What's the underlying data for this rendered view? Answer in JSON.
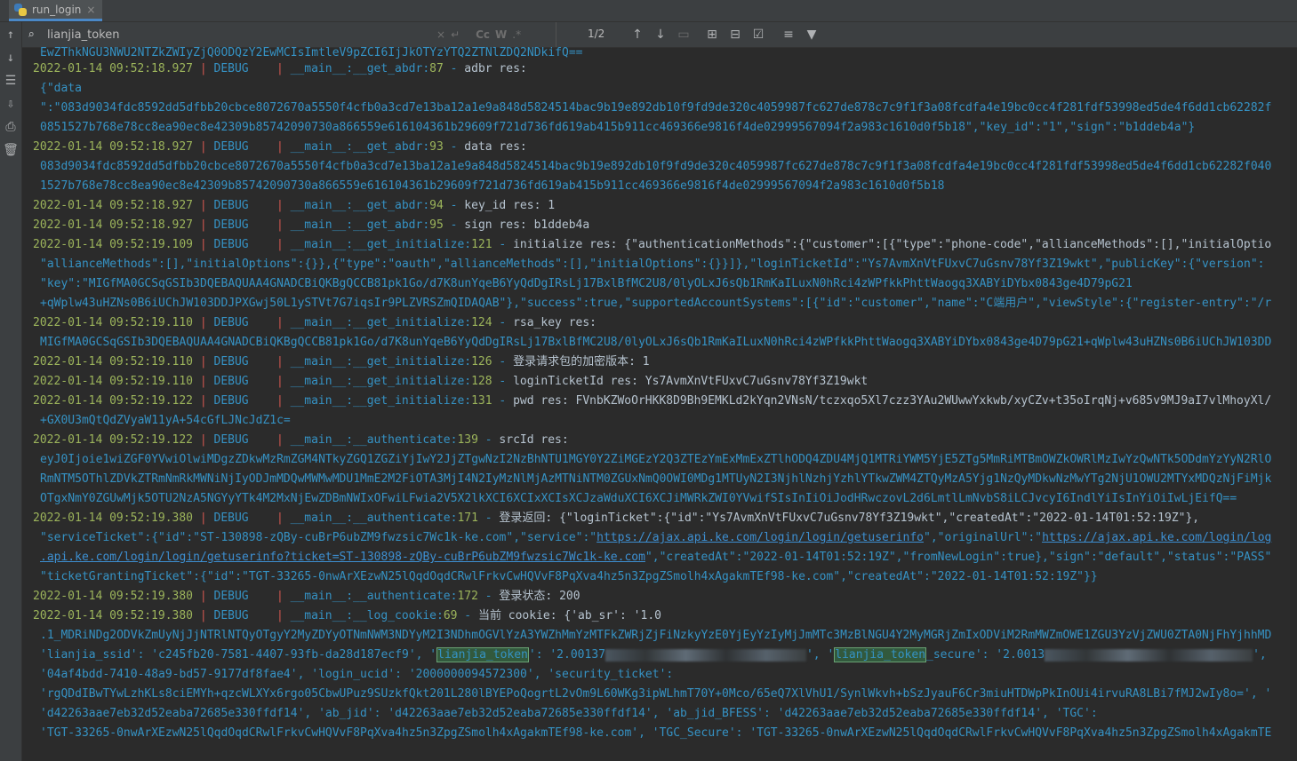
{
  "tab": {
    "label": "run_login",
    "close": "×"
  },
  "search": {
    "query": "lianjia_token",
    "match_count": "1/2",
    "opt_case": "Cc",
    "opt_words": "W",
    "opt_regex": ".*"
  },
  "lines": [
    {
      "type": "cont",
      "text": "EwZThkNGU3NWU2NTZkZWIyZjQ0ODQzY2EwMCIsImtleV9pZCI6IjJkOTYzYTQ2ZTNlZDQ2NDkifQ=="
    },
    {
      "type": "log",
      "ts": "2022-01-14 09:52:18.927",
      "lvl": "DEBUG",
      "mod": "__main__:__get_abdr",
      "ln": "87",
      "msg": "adbr res:"
    },
    {
      "type": "cont",
      "text": "{\"data"
    },
    {
      "type": "cont",
      "text": "\":\"083d9034fdc8592dd5dfbb20cbce8072670a5550f4cfb0a3cd7e13ba12a1e9a848d5824514bac9b19e892db10f9fd9de320c4059987fc627de878c7c9f1f3a08fcdfa4e19bc0cc4f281fdf53998ed5de4f6dd1cb62282f"
    },
    {
      "type": "cont",
      "text": "0851527b768e78cc8ea90ec8e42309b85742090730a866559e616104361b29609f721d736fd619ab415b911cc469366e9816f4de02999567094f2a983c1610d0f5b18\",\"key_id\":\"1\",\"sign\":\"b1ddeb4a\"}"
    },
    {
      "type": "log",
      "ts": "2022-01-14 09:52:18.927",
      "lvl": "DEBUG",
      "mod": "__main__:__get_abdr",
      "ln": "93",
      "msg": "data res:"
    },
    {
      "type": "cont",
      "text": "083d9034fdc8592dd5dfbb20cbce8072670a5550f4cfb0a3cd7e13ba12a1e9a848d5824514bac9b19e892db10f9fd9de320c4059987fc627de878c7c9f1f3a08fcdfa4e19bc0cc4f281fdf53998ed5de4f6dd1cb62282f040"
    },
    {
      "type": "cont",
      "text": "1527b768e78cc8ea90ec8e42309b85742090730a866559e616104361b29609f721d736fd619ab415b911cc469366e9816f4de02999567094f2a983c1610d0f5b18"
    },
    {
      "type": "log",
      "ts": "2022-01-14 09:52:18.927",
      "lvl": "DEBUG",
      "mod": "__main__:__get_abdr",
      "ln": "94",
      "msg": "key_id res: 1"
    },
    {
      "type": "log",
      "ts": "2022-01-14 09:52:18.927",
      "lvl": "DEBUG",
      "mod": "__main__:__get_abdr",
      "ln": "95",
      "msg": "sign res: b1ddeb4a"
    },
    {
      "type": "log",
      "ts": "2022-01-14 09:52:19.109",
      "lvl": "DEBUG",
      "mod": "__main__:__get_initialize",
      "ln": "121",
      "msg": "initialize res: {\"authenticationMethods\":{\"customer\":[{\"type\":\"phone-code\",\"allianceMethods\":[],\"initialOptio"
    },
    {
      "type": "cont",
      "text": "\"allianceMethods\":[],\"initialOptions\":{}},{\"type\":\"oauth\",\"allianceMethods\":[],\"initialOptions\":{}}]},\"loginTicketId\":\"Ys7AvmXnVtFUxvC7uGsnv78Yf3Z19wkt\",\"publicKey\":{\"version\":"
    },
    {
      "type": "cont",
      "text": "\"key\":\"MIGfMA0GCSqGSIb3DQEBAQUAA4GNADCBiQKBgQCCB81pk1Go/d7K8unYqeB6YyQdDgIRsLj17BxlBfMC2U8/0lyOLxJ6sQb1RmKaILuxN0hRci4zWPfkkPhttWaogq3XABYiDYbx0843ge4D79pG21"
    },
    {
      "type": "cont",
      "text": "+qWplw43uHZNs0B6iUChJW103DDJPXGwj50L1ySTVt7G7iqsIr9PLZVRSZmQIDAQAB\"},\"success\":true,\"supportedAccountSystems\":[{\"id\":\"customer\",\"name\":\"C端用户\",\"viewStyle\":{\"register-entry\":\"/r"
    },
    {
      "type": "log",
      "ts": "2022-01-14 09:52:19.110",
      "lvl": "DEBUG",
      "mod": "__main__:__get_initialize",
      "ln": "124",
      "msg": "rsa_key res:"
    },
    {
      "type": "cont",
      "text": "MIGfMA0GCSqGSIb3DQEBAQUAA4GNADCBiQKBgQCCB81pk1Go/d7K8unYqeB6YyQdDgIRsLj17BxlBfMC2U8/0lyOLxJ6sQb1RmKaILuxN0hRci4zWPfkkPhttWaogq3XABYiDYbx0843ge4D79pG21+qWplw43uHZNs0B6iUChJW103DD"
    },
    {
      "type": "log",
      "ts": "2022-01-14 09:52:19.110",
      "lvl": "DEBUG",
      "mod": "__main__:__get_initialize",
      "ln": "126",
      "msg": "登录请求包的加密版本: 1"
    },
    {
      "type": "log",
      "ts": "2022-01-14 09:52:19.110",
      "lvl": "DEBUG",
      "mod": "__main__:__get_initialize",
      "ln": "128",
      "msg": "loginTicketId res: Ys7AvmXnVtFUxvC7uGsnv78Yf3Z19wkt"
    },
    {
      "type": "log",
      "ts": "2022-01-14 09:52:19.122",
      "lvl": "DEBUG",
      "mod": "__main__:__get_initialize",
      "ln": "131",
      "msg": "pwd res: FVnbKZWoOrHKK8D9Bh9EMKLd2kYqn2VNsN/tczxqo5Xl7czz3YAu2WUwwYxkwb/xyCZv+t35oIrqNj+v685v9MJ9aI7vlMhoyXl/"
    },
    {
      "type": "cont",
      "text": "+GX0U3mQtQdZVyaW11yA+54cGfLJNcJdZ1c="
    },
    {
      "type": "log",
      "ts": "2022-01-14 09:52:19.122",
      "lvl": "DEBUG",
      "mod": "__main__:__authenticate",
      "ln": "139",
      "msg": "srcId res:"
    },
    {
      "type": "cont",
      "text": "eyJ0Ijoie1wiZGF0YVwiOlwiMDgzZDkwMzRmZGM4NTkyZGQ1ZGZiYjIwY2JjZTgwNzI2NzBhNTU1MGY0Y2ZiMGEzY2Q3ZTEzYmExMmExZTlhODQ4ZDU4MjQ1MTRiYWM5YjE5ZTg5MmRiMTBmOWZkOWRlMzIwYzQwNTk5ODdmYzYyN2RlO"
    },
    {
      "type": "cont",
      "text": "RmNTM5OThlZDVkZTRmNmRkMWNiNjIyODJmMDQwMWMwMDU1MmE2M2FiOTA3MjI4N2IyMzNlMjAzMTNiNTM0ZGUxNmQ0OWI0MDg1MTUyN2I3NjhlNzhjYzhlYTkwZWM4ZTQyMzA5Yjg1NzQyMDkwNzMwYTg2NjU1OWU2MTYxMDQzNjFiMjk"
    },
    {
      "type": "cont",
      "text": "OTgxNmY0ZGUwMjk5OTU2NzA5NGYyYTk4M2MxNjEwZDBmNWIxOFwiLFwia2V5X2lkXCI6XCIxXCIsXCJzaWduXCI6XCJiMWRkZWI0YVwifSIsInIiOiJodHRwczovL2d6LmtlLmNvbS8iLCJvcyI6IndlYiIsInYiOiIwLjEifQ=="
    },
    {
      "type": "log",
      "ts": "2022-01-14 09:52:19.380",
      "lvl": "DEBUG",
      "mod": "__main__:__authenticate",
      "ln": "171",
      "msg": "登录返回: {\"loginTicket\":{\"id\":\"Ys7AvmXnVtFUxvC7uGsnv78Yf3Z19wkt\",\"createdAt\":\"2022-01-14T01:52:19Z\"},"
    },
    {
      "type": "svc",
      "pre": "\"serviceTicket\":{\"id\":\"ST-130898-zQBy-cuBrP6ubZM9fwzsic7Wc1k-ke.com\",\"service\":\"",
      "link1": "https://ajax.api.ke.com/login/login/getuserinfo",
      "mid": "\",\"originalUrl\":\"",
      "link2": "https://ajax.api.ke.com/login/log"
    },
    {
      "type": "svc2",
      "link": ".api.ke.com/login/login/getuserinfo?ticket=ST-130898-zQBy-cuBrP6ubZM9fwzsic7Wc1k-ke.com",
      "post": "\",\"createdAt\":\"2022-01-14T01:52:19Z\",\"fromNewLogin\":true},\"sign\":\"default\",\"status\":\"PASS\""
    },
    {
      "type": "cont",
      "text": "\"ticketGrantingTicket\":{\"id\":\"TGT-33265-0nwArXEzwN25lQqdOqdCRwlFrkvCwHQVvF8PqXva4hz5n3ZpgZSmolh4xAgakmTEf98-ke.com\",\"createdAt\":\"2022-01-14T01:52:19Z\"}}"
    },
    {
      "type": "log",
      "ts": "2022-01-14 09:52:19.380",
      "lvl": "DEBUG",
      "mod": "__main__:__authenticate",
      "ln": "172",
      "msg": "登录状态: 200"
    },
    {
      "type": "log",
      "ts": "2022-01-14 09:52:19.380",
      "lvl": "DEBUG",
      "mod": "__main__:__log_cookie",
      "ln": "69",
      "msg": "当前 cookie: {'ab_sr': '1.0"
    },
    {
      "type": "cont",
      "text": ".1_MDRiNDg2ODVkZmUyNjJjNTRlNTQyOTgyY2MyZDYyOTNmNWM3NDYyM2I3NDhmOGVlYzA3YWZhMmYzMTFkZWRjZjFiNzkyYzE0YjEyYzIyMjJmMTc3MzBlNGU4Y2MyMGRjZmIxODViM2RmMWZmOWE1ZGU3YzVjZWU0ZTA0NjFhYjhhMD"
    },
    {
      "type": "tok",
      "a": "'lianjia_ssid': 'c245fb20-7581-4407-93fb-da28d187ecf9', '",
      "hl1": "lianjia_token",
      "b": "': '2.00137",
      "c": "', '",
      "hl2": "lianjia_token",
      "d": "_secure': '2.0013",
      "e": "',"
    },
    {
      "type": "cont",
      "text": "'04af4bdd-7410-48a9-bd57-9177df8fae4', 'login_ucid': '2000000094572300', 'security_ticket':"
    },
    {
      "type": "cont",
      "text": "'rgQDdIBwTYwLzhKLs8ciEMYh+qzcWLXYx6rgo05CbwUPuz9SUzkfQkt201L280lBYEPoQogrtL2vOm9L60WKg3ipWLhmT70Y+0Mco/65eQ7XlVhU1/SynlWkvh+bSzJyauF6Cr3miuHTDWpPkInOUi4irvuRA8LBi7fMJ2wIy8o=', '"
    },
    {
      "type": "cont",
      "text": "'d42263aae7eb32d52eaba72685e330ffdf14', 'ab_jid': 'd42263aae7eb32d52eaba72685e330ffdf14', 'ab_jid_BFESS': 'd42263aae7eb32d52eaba72685e330ffdf14', 'TGC':"
    },
    {
      "type": "cont",
      "text": "'TGT-33265-0nwArXEzwN25lQqdOqdCRwlFrkvCwHQVvF8PqXva4hz5n3ZpgZSmolh4xAgakmTEf98-ke.com', 'TGC_Secure': 'TGT-33265-0nwArXEzwN25lQqdOqdCRwlFrkvCwHQVvF8PqXva4hz5n3ZpgZSmolh4xAgakmTE"
    }
  ]
}
